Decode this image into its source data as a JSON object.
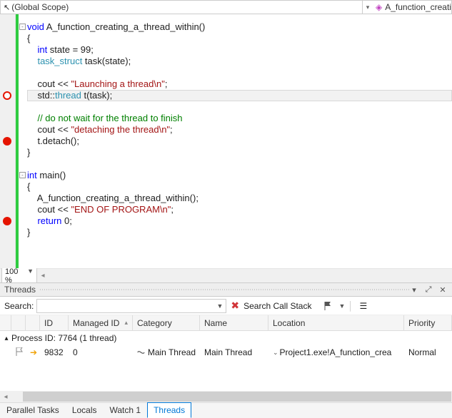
{
  "topbar": {
    "scope": "(Global Scope)",
    "function_label": "A_function_creatin"
  },
  "zoom": "100 %",
  "code": {
    "lines": [
      {
        "frag": [
          {
            "c": "kw",
            "t": "void"
          },
          {
            "t": " A_function_creating_a_thread_within()"
          }
        ]
      },
      {
        "frag": [
          {
            "t": "{"
          }
        ]
      },
      {
        "frag": [
          {
            "t": "    "
          },
          {
            "c": "kw",
            "t": "int"
          },
          {
            "t": " state = 99;"
          }
        ]
      },
      {
        "frag": [
          {
            "t": "    "
          },
          {
            "c": "type",
            "t": "task_struct"
          },
          {
            "t": " task(state);"
          }
        ]
      },
      {
        "frag": []
      },
      {
        "frag": [
          {
            "t": "    cout << "
          },
          {
            "c": "str",
            "t": "\"Launching a thread\\n\""
          },
          {
            "t": ";"
          }
        ]
      },
      {
        "frag": [
          {
            "t": "    std::"
          },
          {
            "c": "type",
            "t": "thread"
          },
          {
            "t": " t(task);"
          }
        ]
      },
      {
        "frag": []
      },
      {
        "frag": [
          {
            "t": "    "
          },
          {
            "c": "cmt",
            "t": "// do not wait for the thread to finish"
          }
        ]
      },
      {
        "frag": [
          {
            "t": "    cout << "
          },
          {
            "c": "str",
            "t": "\"detaching the thread\\n\""
          },
          {
            "t": ";"
          }
        ]
      },
      {
        "frag": [
          {
            "t": "    t.detach();"
          }
        ]
      },
      {
        "frag": [
          {
            "t": "}"
          }
        ]
      },
      {
        "frag": []
      },
      {
        "frag": [
          {
            "c": "kw",
            "t": "int"
          },
          {
            "t": " main()"
          }
        ]
      },
      {
        "frag": [
          {
            "t": "{"
          }
        ]
      },
      {
        "frag": [
          {
            "t": "    A_function_creating_a_thread_within();"
          }
        ]
      },
      {
        "frag": [
          {
            "t": "    cout << "
          },
          {
            "c": "str",
            "t": "\"END OF PROGRAM\\n\""
          },
          {
            "t": ";"
          }
        ]
      },
      {
        "frag": [
          {
            "t": "    "
          },
          {
            "c": "kw",
            "t": "return"
          },
          {
            "t": " 0;"
          }
        ]
      },
      {
        "frag": [
          {
            "t": "}"
          }
        ]
      }
    ],
    "breakpoints": [
      {
        "line": 6,
        "ring": true
      },
      {
        "line": 10
      },
      {
        "line": 17
      }
    ],
    "folds": [
      {
        "line": 0
      },
      {
        "line": 13
      }
    ],
    "highlighted_line": 6
  },
  "panel": {
    "title": "Threads",
    "search_label": "Search:",
    "search_placeholder": "",
    "search_callstack_label": "Search Call Stack",
    "columns": {
      "id": "ID",
      "managed_id": "Managed ID",
      "category": "Category",
      "name": "Name",
      "location": "Location",
      "priority": "Priority"
    },
    "process_row": "Process ID: 7764  (1 thread)",
    "thread": {
      "id": "9832",
      "managed_id": "0",
      "category": "Main Thread",
      "name": "Main Thread",
      "location": "Project1.exe!A_function_crea",
      "priority": "Normal"
    }
  },
  "tabs": [
    {
      "label": "Parallel Tasks",
      "active": false
    },
    {
      "label": "Locals",
      "active": false
    },
    {
      "label": "Watch 1",
      "active": false
    },
    {
      "label": "Threads",
      "active": true
    }
  ]
}
